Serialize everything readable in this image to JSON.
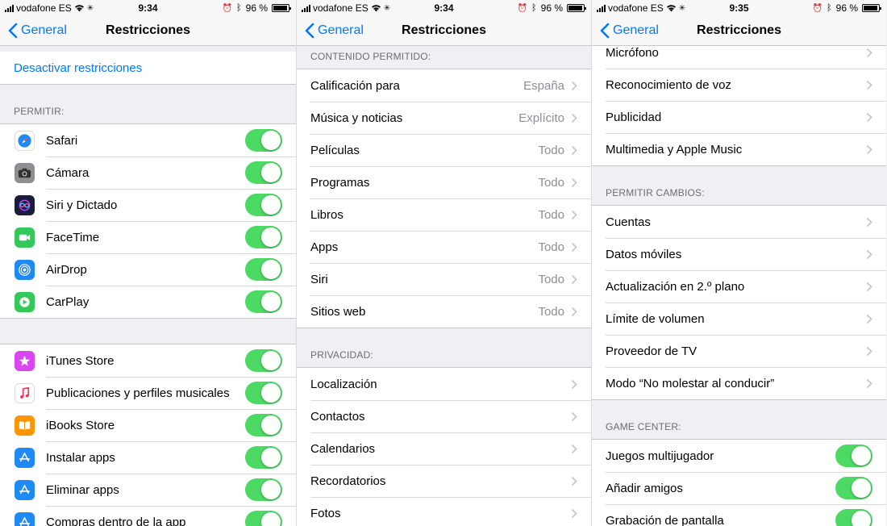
{
  "colors": {
    "accent": "#007aff",
    "toggle_on": "#4cd964",
    "background": "#efeff4"
  },
  "status": {
    "carrier": "vodafone ES",
    "battery": "96 %",
    "battery_level": 0.96
  },
  "screens": [
    {
      "time": "9:34",
      "back": "General",
      "title": "Restricciones",
      "disable": "Desactivar restricciones",
      "permitir_header": "PERMITIR:",
      "allow": [
        {
          "label": "Safari",
          "icon": "safari-icon",
          "color": "#1f8af5",
          "on": true
        },
        {
          "label": "Cámara",
          "icon": "camera-icon",
          "color": "#8e8e93",
          "on": true
        },
        {
          "label": "Siri y Dictado",
          "icon": "siri-icon",
          "color": "#1c1c3c",
          "on": true
        },
        {
          "label": "FaceTime",
          "icon": "facetime-icon",
          "color": "#34c759",
          "on": true
        },
        {
          "label": "AirDrop",
          "icon": "airdrop-icon",
          "color": "#1f8af5",
          "on": true
        },
        {
          "label": "CarPlay",
          "icon": "carplay-icon",
          "color": "#34c759",
          "on": true
        }
      ],
      "stores": [
        {
          "label": "iTunes Store",
          "icon": "itunes-star-icon",
          "color": "#d946ef",
          "on": true
        },
        {
          "label": "Publicaciones y perfiles musicales",
          "icon": "music-note-icon",
          "color": "#ffffff",
          "on": true
        },
        {
          "label": "iBooks Store",
          "icon": "ibooks-icon",
          "color": "#ff9500",
          "on": true
        },
        {
          "label": "Instalar apps",
          "icon": "app-store-icon",
          "color": "#1f8af5",
          "on": true
        },
        {
          "label": "Eliminar apps",
          "icon": "app-store-icon",
          "color": "#1f8af5",
          "on": true
        },
        {
          "label": "Compras dentro de la app",
          "icon": "app-store-icon",
          "color": "#1f8af5",
          "on": true
        }
      ]
    },
    {
      "time": "9:34",
      "back": "General",
      "title": "Restricciones",
      "contenido_header": "CONTENIDO PERMITIDO:",
      "contenido": [
        {
          "label": "Calificación para",
          "value": "España"
        },
        {
          "label": "Música y noticias",
          "value": "Explícito"
        },
        {
          "label": "Películas",
          "value": "Todo"
        },
        {
          "label": "Programas",
          "value": "Todo"
        },
        {
          "label": "Libros",
          "value": "Todo"
        },
        {
          "label": "Apps",
          "value": "Todo"
        },
        {
          "label": "Siri",
          "value": "Todo"
        },
        {
          "label": "Sitios web",
          "value": "Todo"
        }
      ],
      "privacidad_header": "PRIVACIDAD:",
      "privacidad": [
        {
          "label": "Localización"
        },
        {
          "label": "Contactos"
        },
        {
          "label": "Calendarios"
        },
        {
          "label": "Recordatorios"
        },
        {
          "label": "Fotos"
        }
      ]
    },
    {
      "time": "9:35",
      "back": "General",
      "title": "Restricciones",
      "privacidad_rest": [
        {
          "label": "Micrófono"
        },
        {
          "label": "Reconocimiento de voz"
        },
        {
          "label": "Publicidad"
        },
        {
          "label": "Multimedia y Apple Music"
        }
      ],
      "cambios_header": "PERMITIR CAMBIOS:",
      "cambios": [
        {
          "label": "Cuentas"
        },
        {
          "label": "Datos móviles"
        },
        {
          "label": "Actualización en 2.º plano"
        },
        {
          "label": "Límite de volumen"
        },
        {
          "label": "Proveedor de TV"
        },
        {
          "label": "Modo “No molestar al conducir”"
        }
      ],
      "gamecenter_header": "GAME CENTER:",
      "gamecenter": [
        {
          "label": "Juegos multijugador",
          "on": true
        },
        {
          "label": "Añadir amigos",
          "on": true
        },
        {
          "label": "Grabación de pantalla",
          "on": true
        }
      ]
    }
  ]
}
